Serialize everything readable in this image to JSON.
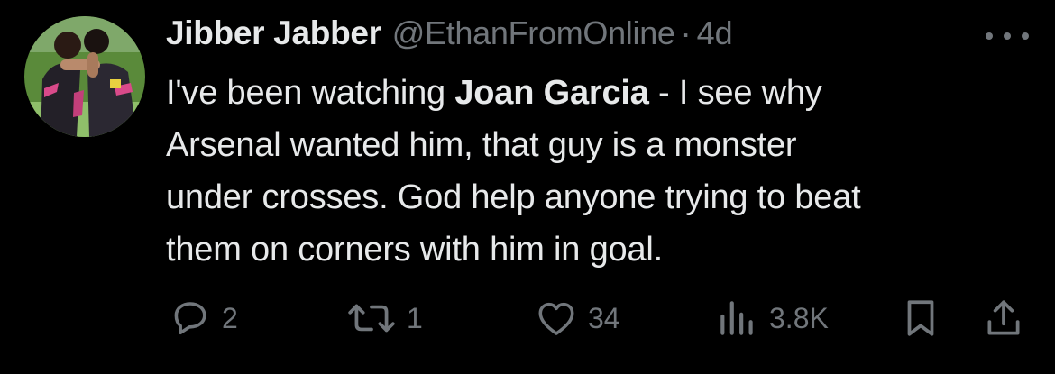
{
  "tweet": {
    "author": {
      "display_name": "Jibber Jabber",
      "handle": "@EthanFromOnline",
      "separator": "·",
      "timestamp": "4d"
    },
    "text": {
      "line1_pre": "I've been watching ",
      "line1_bold": "Joan Garcia",
      "line1_post": " - I see why",
      "line2": "Arsenal wanted him, that guy is a monster",
      "line3": "under crosses. God help anyone trying to beat",
      "line4": "them on corners with him in goal."
    },
    "actions": {
      "reply": {
        "icon": "reply-bubble-icon",
        "count": "2"
      },
      "repost": {
        "icon": "repost-arrows-icon",
        "count": "1"
      },
      "like": {
        "icon": "heart-icon",
        "count": "34"
      },
      "views": {
        "icon": "bar-chart-icon",
        "count": "3.8K"
      },
      "bookmark": {
        "icon": "bookmark-icon"
      },
      "share": {
        "icon": "share-upload-icon"
      }
    },
    "more_icon": "more-dots-icon"
  },
  "colors": {
    "background": "#000000",
    "primary_text": "#e7e9ea",
    "secondary_text": "#71767b"
  }
}
